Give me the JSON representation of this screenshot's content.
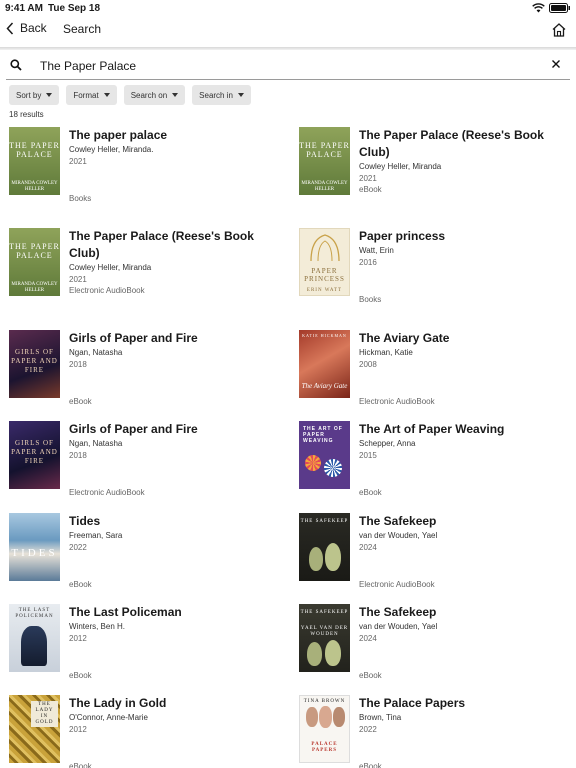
{
  "status_bar": {
    "time": "9:41 AM",
    "date": "Tue Sep 18"
  },
  "nav": {
    "back_label": "Back",
    "title": "Search"
  },
  "search": {
    "value": "The Paper Palace",
    "placeholder": ""
  },
  "filters": [
    "Sort by",
    "Format",
    "Search on",
    "Search in"
  ],
  "result_count": "18 results",
  "results": [
    {
      "title": "The paper palace",
      "author": "Cowley Heller, Miranda.",
      "year": "2021",
      "format": "Books"
    },
    {
      "title": "The Paper Palace (Reese's Book Club)",
      "author": "Cowley Heller, Miranda",
      "year": "2021",
      "format": "eBook"
    },
    {
      "title": "The Paper Palace (Reese's Book Club)",
      "author": "Cowley Heller, Miranda",
      "year": "2021",
      "format": "Electronic AudioBook"
    },
    {
      "title": "Paper princess",
      "author": "Watt, Erin",
      "year": "2016",
      "format": "Books"
    },
    {
      "title": "Girls of Paper and Fire",
      "author": "Ngan, Natasha",
      "year": "2018",
      "format": "eBook"
    },
    {
      "title": "The Aviary Gate",
      "author": "Hickman, Katie",
      "year": "2008",
      "format": "Electronic AudioBook"
    },
    {
      "title": "Girls of Paper and Fire",
      "author": "Ngan, Natasha",
      "year": "2018",
      "format": "Electronic AudioBook"
    },
    {
      "title": "The Art of Paper Weaving",
      "author": "Schepper, Anna",
      "year": "2015",
      "format": "eBook"
    },
    {
      "title": "Tides",
      "author": "Freeman, Sara",
      "year": "2022",
      "format": "eBook"
    },
    {
      "title": "The Safekeep",
      "author": "van der Wouden, Yael",
      "year": "2024",
      "format": "Electronic AudioBook"
    },
    {
      "title": "The Last Policeman",
      "author": "Winters, Ben H.",
      "year": "2012",
      "format": "eBook"
    },
    {
      "title": "The Safekeep",
      "author": "van der Wouden, Yael",
      "year": "2024",
      "format": "eBook"
    },
    {
      "title": "The Lady in Gold",
      "author": "O'Connor, Anne-Marie",
      "year": "2012",
      "format": "eBook"
    },
    {
      "title": "The Palace Papers",
      "author": "Brown, Tina",
      "year": "2022",
      "format": "eBook"
    }
  ],
  "covers": {
    "paper_palace_1": "THE PAPER PALACE",
    "paper_palace_1_author": "MIRANDA COWLEY HELLER",
    "paper_princess": "PAPER PRINCESS",
    "paper_princess_author": "ERIN WATT",
    "girls": "GIRLS OF PAPER AND FIRE",
    "aviary": "The Aviary Gate",
    "aviary_author": "KATIE HICKMAN",
    "weaving": "THE ART OF PAPER WEAVING",
    "tides": "TIDES",
    "safekeep": "THE SAFEKEEP",
    "safekeep_author": "YAEL VAN DER WOUDEN",
    "policeman": "THE LAST POLICEMAN",
    "lady": "THE LADY IN GOLD",
    "palace_papers": "PALACE PAPERS",
    "palace_papers_author": "TINA BROWN"
  }
}
